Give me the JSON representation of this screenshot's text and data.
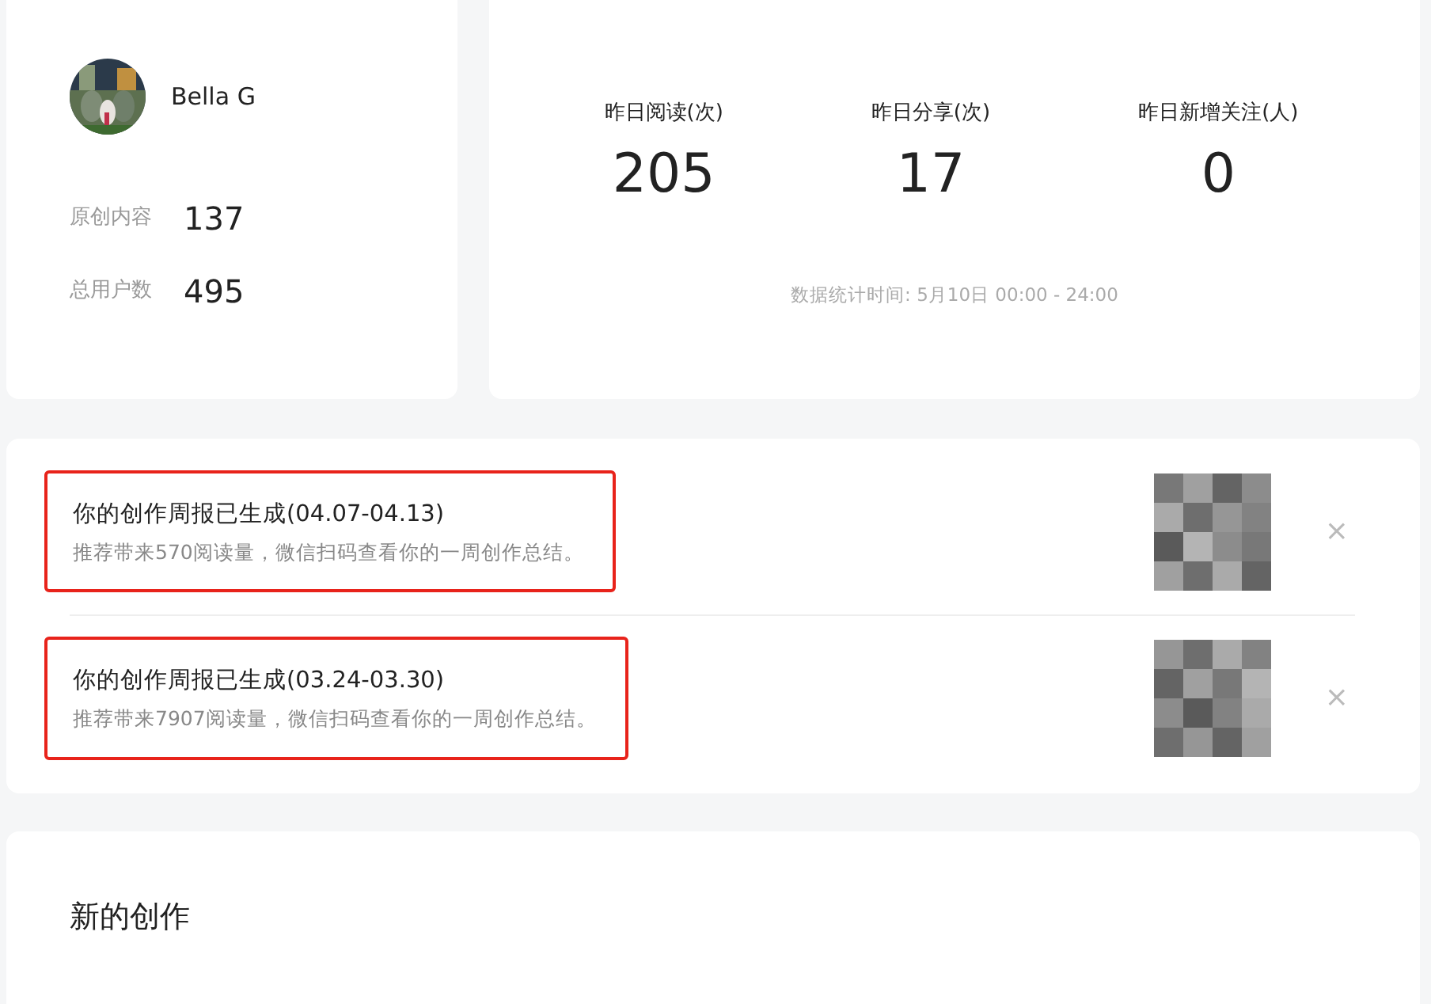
{
  "profile": {
    "name": "Bella G",
    "stats": [
      {
        "label": "原创内容",
        "value": "137"
      },
      {
        "label": "总用户数",
        "value": "495"
      }
    ]
  },
  "yesterday": {
    "metrics": [
      {
        "label": "昨日阅读(次)",
        "value": "205"
      },
      {
        "label": "昨日分享(次)",
        "value": "17"
      },
      {
        "label": "昨日新增关注(人)",
        "value": "0"
      }
    ],
    "footnote": "数据统计时间: 5月10日 00:00 - 24:00"
  },
  "notices": [
    {
      "title": "你的创作周报已生成(04.07-04.13)",
      "text": "推荐带来570阅读量，微信扫码查看你的一周创作总结。",
      "highlighted": true,
      "close": "×"
    },
    {
      "title": "你的创作周报已生成(03.24-03.30)",
      "text": "推荐带来7907阅读量，微信扫码查看你的一周创作总结。",
      "highlighted": true,
      "close": "×"
    }
  ],
  "new_creation": {
    "title": "新的创作"
  }
}
